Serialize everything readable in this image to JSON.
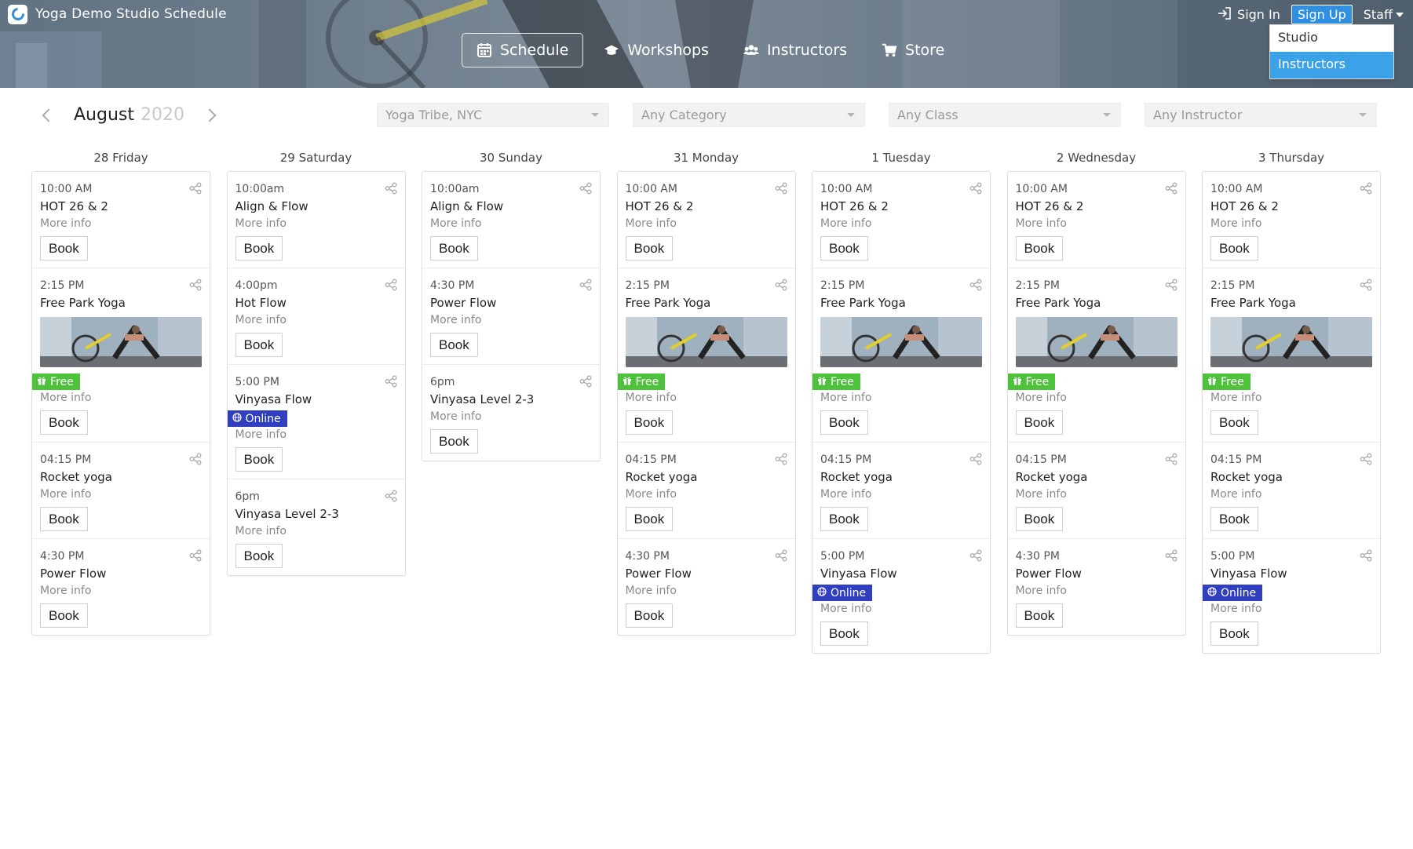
{
  "app": {
    "title": "Yoga Demo Studio Schedule"
  },
  "nav": {
    "schedule": "Schedule",
    "workshops": "Workshops",
    "instructors": "Instructors",
    "store": "Store"
  },
  "account": {
    "sign_in": "Sign In",
    "sign_up": "Sign Up",
    "staff": "Staff",
    "staff_menu": [
      "Studio",
      "Instructors"
    ]
  },
  "toolbar": {
    "month": "August",
    "year": "2020",
    "location": "Yoga Tribe, NYC",
    "category": "Any Category",
    "class": "Any Class",
    "instructor": "Any Instructor"
  },
  "labels": {
    "more_info": "More info",
    "book": "Book",
    "free": "Free",
    "online": "Online"
  },
  "colors": {
    "free_badge": "#4fc23c",
    "online_badge": "#2f3fbf",
    "sign_up": "#2f8fe1",
    "menu_highlight": "#3ba2e8"
  },
  "days": [
    {
      "label": "28 Friday",
      "entries": [
        {
          "time": "10:00 AM",
          "name": "HOT 26 & 2"
        },
        {
          "time": "2:15 PM",
          "name": "Free Park Yoga",
          "image": true,
          "badge": "free"
        },
        {
          "time": "04:15 PM",
          "name": "Rocket yoga"
        },
        {
          "time": "4:30 PM",
          "name": "Power Flow"
        }
      ]
    },
    {
      "label": "29 Saturday",
      "entries": [
        {
          "time": "10:00am",
          "name": "Align & Flow"
        },
        {
          "time": "4:00pm",
          "name": "Hot Flow"
        },
        {
          "time": "5:00 PM",
          "name": "Vinyasa Flow",
          "badge": "online"
        },
        {
          "time": "6pm",
          "name": "Vinyasa Level 2-3"
        }
      ]
    },
    {
      "label": "30 Sunday",
      "entries": [
        {
          "time": "10:00am",
          "name": "Align & Flow"
        },
        {
          "time": "4:30 PM",
          "name": "Power Flow"
        },
        {
          "time": "6pm",
          "name": "Vinyasa Level 2-3"
        }
      ]
    },
    {
      "label": "31 Monday",
      "entries": [
        {
          "time": "10:00 AM",
          "name": "HOT 26 & 2"
        },
        {
          "time": "2:15 PM",
          "name": "Free Park Yoga",
          "image": true,
          "badge": "free"
        },
        {
          "time": "04:15 PM",
          "name": "Rocket yoga"
        },
        {
          "time": "4:30 PM",
          "name": "Power Flow"
        }
      ]
    },
    {
      "label": "1 Tuesday",
      "entries": [
        {
          "time": "10:00 AM",
          "name": "HOT 26 & 2"
        },
        {
          "time": "2:15 PM",
          "name": "Free Park Yoga",
          "image": true,
          "badge": "free"
        },
        {
          "time": "04:15 PM",
          "name": "Rocket yoga"
        },
        {
          "time": "5:00 PM",
          "name": "Vinyasa Flow",
          "badge": "online"
        }
      ]
    },
    {
      "label": "2 Wednesday",
      "entries": [
        {
          "time": "10:00 AM",
          "name": "HOT 26 & 2"
        },
        {
          "time": "2:15 PM",
          "name": "Free Park Yoga",
          "image": true,
          "badge": "free"
        },
        {
          "time": "04:15 PM",
          "name": "Rocket yoga"
        },
        {
          "time": "4:30 PM",
          "name": "Power Flow"
        }
      ]
    },
    {
      "label": "3 Thursday",
      "entries": [
        {
          "time": "10:00 AM",
          "name": "HOT 26 & 2"
        },
        {
          "time": "2:15 PM",
          "name": "Free Park Yoga",
          "image": true,
          "badge": "free"
        },
        {
          "time": "04:15 PM",
          "name": "Rocket yoga"
        },
        {
          "time": "5:00 PM",
          "name": "Vinyasa Flow",
          "badge": "online"
        }
      ]
    }
  ]
}
